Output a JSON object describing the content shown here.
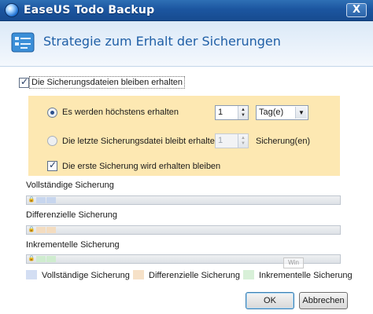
{
  "window": {
    "title": "EaseUS Todo Backup",
    "close_label": "X"
  },
  "header": {
    "title": "Strategie zum Erhalt der Sicherungen"
  },
  "main_option": {
    "label": "Die Sicherungsdateien bleiben  erhalten",
    "checked": true
  },
  "options": {
    "radio1": {
      "label": "Es werden höchstens erhalten",
      "checked": true,
      "spinner_value": "1",
      "unit_selected": "Tag(e)"
    },
    "radio2": {
      "label": "Die letzte Sicherungsdatei bleibt erhalten",
      "checked": false,
      "spinner_value": "1",
      "unit_label": "Sicherung(en)"
    },
    "first_backup": {
      "label": "Die erste Sicherung wird erhalten bleiben",
      "checked": true
    }
  },
  "bars": [
    {
      "label": "Vollständige Sicherung",
      "color": "#c7d6ee"
    },
    {
      "label": "Differenzielle Sicherung",
      "color": "#f3dcc0"
    },
    {
      "label": "Inkrementelle Sicherung",
      "color": "#cfeccf"
    }
  ],
  "legend": [
    {
      "label": "Vollständige Sicherung",
      "color": "#d3def3"
    },
    {
      "label": "Differenzielle Sicherung",
      "color": "#f6e1c8"
    },
    {
      "label": "Inkrementelle Sicherung",
      "color": "#d8f0d8"
    }
  ],
  "watermark": "Win",
  "buttons": {
    "ok": "OK",
    "cancel": "Abbrechen"
  },
  "colors": {
    "title_bar": "#1c56a0",
    "options_panel": "#fde8b2",
    "header_title": "#1f5fa6"
  }
}
